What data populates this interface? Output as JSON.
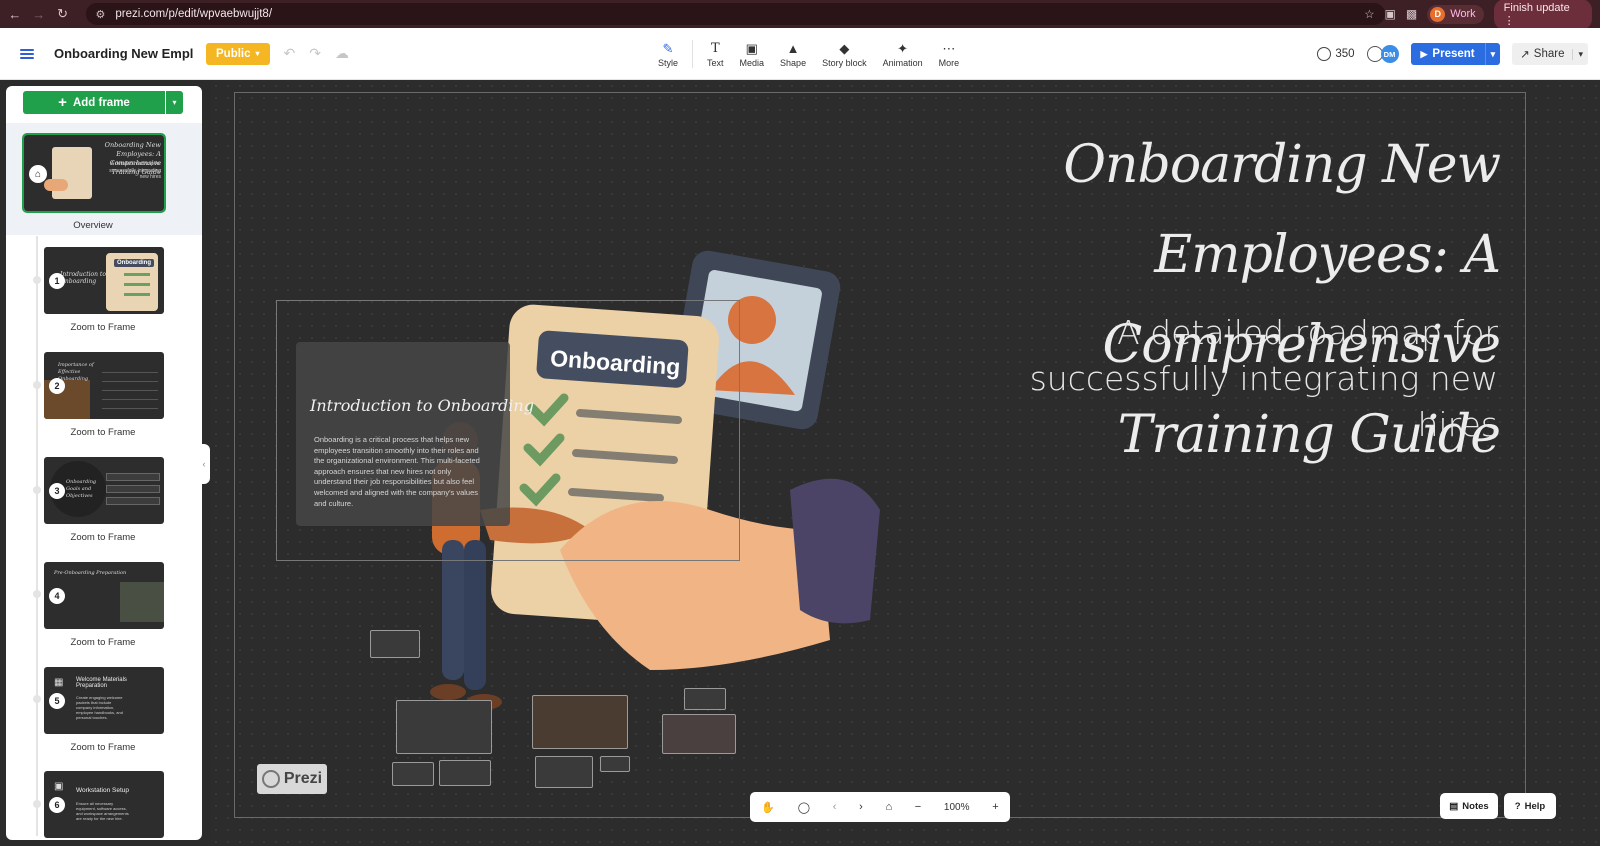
{
  "browser": {
    "url": "prezi.com/p/edit/wpvaebwujjt8/",
    "profile_initial": "D",
    "profile_label": "Work",
    "finish_update": "Finish update"
  },
  "app": {
    "doc_title": "Onboarding New Empl...",
    "visibility": "Public",
    "credits": "350",
    "collab_initials": "DM",
    "present": "Present",
    "share": "Share"
  },
  "tools": [
    {
      "label": "Style",
      "icon": "pen-icon"
    },
    {
      "label": "Text",
      "icon": "text-icon"
    },
    {
      "label": "Media",
      "icon": "image-icon"
    },
    {
      "label": "Shape",
      "icon": "shape-icon"
    },
    {
      "label": "Story block",
      "icon": "layers-icon"
    },
    {
      "label": "Animation",
      "icon": "animation-icon"
    },
    {
      "label": "More",
      "icon": "more-icon"
    }
  ],
  "sidebar": {
    "add_frame": "Add frame",
    "overview_label": "Overview",
    "overview_thumb": {
      "title": "Onboarding New Employees: A Comprehensive Training Guide",
      "subtitle": "A detailed roadmap for successfully integrating new hires"
    },
    "frames": [
      {
        "num": "1",
        "label": "Zoom to Frame",
        "title": "Introduction to Onboarding",
        "badge": "Onboarding"
      },
      {
        "num": "2",
        "label": "Zoom to Frame",
        "title": "Importance of Effective Onboarding"
      },
      {
        "num": "3",
        "label": "Zoom to Frame",
        "title": "Onboarding Goals and Objectives"
      },
      {
        "num": "4",
        "label": "Zoom to Frame",
        "title": "Pre-Onboarding Preparation"
      },
      {
        "num": "5",
        "label": "Zoom to Frame",
        "title": "Welcome Materials Preparation",
        "body": "Create engaging welcome packets that include company information, employee handbooks, and personal touches."
      },
      {
        "num": "6",
        "label": "",
        "title": "Workstation Setup",
        "body": "Ensure all necessary equipment, software access, and workspace arrangements are ready for the new hire."
      }
    ]
  },
  "canvas": {
    "title": "Onboarding New Employees: A Comprehensive Training Guide",
    "subtitle": "A detailed roadmap for successfully integrating new hires",
    "clipboard_label": "Onboarding",
    "intro_title": "Introduction to Onboarding",
    "intro_body": "Onboarding is a critical process that helps new employees transition smoothly into their roles and the organizational environment. This multi-faceted approach ensures that new hires not only understand their job responsibilities but also feel welcomed and aligned with the company's values and culture.",
    "logo": "Prezi"
  },
  "navbar": {
    "zoom": "100%"
  },
  "bottom": {
    "notes": "Notes",
    "help": "Help"
  },
  "colors": {
    "accent": "#2b6de0",
    "add_frame": "#20a04b",
    "public": "#f4b622",
    "chrome": "#3d1f26"
  }
}
